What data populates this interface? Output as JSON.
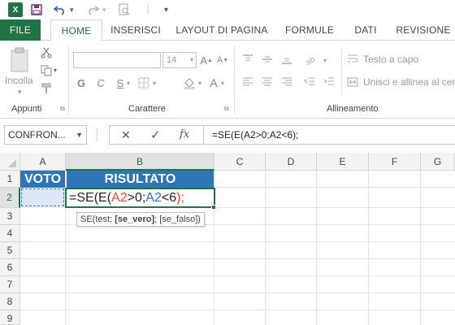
{
  "app": {
    "logo_text": "X",
    "accent_color": "#217346",
    "header_fill_color": "#2e75b6"
  },
  "qat": {
    "save_icon": "save-icon",
    "undo_icon": "undo-icon",
    "redo_icon": "redo-icon",
    "print_preview_icon": "print-preview-icon",
    "customize_icon": "customize-qat-icon"
  },
  "tabs": {
    "file": "FILE",
    "home": "HOME",
    "insert": "INSERISCI",
    "page_layout": "LAYOUT DI PAGINA",
    "formulas": "FORMULE",
    "data": "DATI",
    "review": "REVISIONE"
  },
  "ribbon": {
    "paste_label": "Incolla",
    "clipboard_group": "Appunti",
    "font_size": "14",
    "font_group": "Carattere",
    "bold": "G",
    "italic": "C",
    "underline": "S",
    "grow_font": "A",
    "shrink_font": "A",
    "wrap_text": "Testo a capo",
    "merge_center": "Unisci e allinea al centro",
    "alignment_group": "Allineamento"
  },
  "formula_bar": {
    "name_box": "CONFRON...",
    "cancel": "✕",
    "enter": "✓",
    "fx": "fx",
    "formula": "=SE(E(A2>0;A2<6);"
  },
  "grid": {
    "columns": [
      "A",
      "B",
      "C",
      "D",
      "E",
      "F",
      "G"
    ],
    "rows": [
      "1",
      "2",
      "3",
      "4",
      "5",
      "6",
      "7",
      "8",
      "9"
    ],
    "a1": "VOTO",
    "b1": "RISULTATO",
    "b2_parts": {
      "p1": "=SE(E(",
      "ref1": "A2",
      "p2": ">0;",
      "ref2": "A2",
      "p3": "<6",
      "p4": ");"
    },
    "tooltip": {
      "fn": "SE(test; ",
      "active_arg": "[se_vero]",
      "rest": "; [se_falso])"
    }
  }
}
